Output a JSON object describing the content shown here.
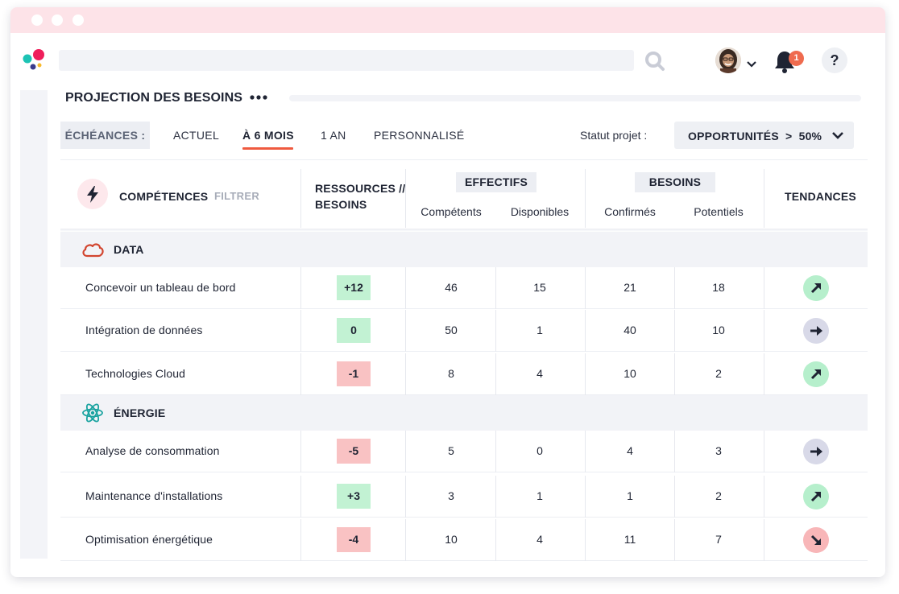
{
  "header": {
    "notification_count": "1",
    "help_label": "?"
  },
  "page": {
    "title": "PROJECTION DES BESOINS"
  },
  "echeances": {
    "label": "ÉCHÉANCES :",
    "tabs": [
      "ACTUEL",
      "À 6 MOIS",
      "1 AN",
      "PERSONNALISÉ"
    ],
    "active_tab": "À 6 MOIS"
  },
  "statut": {
    "label": "Statut projet :",
    "value": "OPPORTUNITÉS  >  50%"
  },
  "table": {
    "competences_header": "COMPÉTENCES",
    "filter_label": "FILTRER",
    "ressources_header_line1": "RESSOURCES //",
    "ressources_header_line2": "BESOINS",
    "effectifs_header": "EFFECTIFS",
    "effectifs_sub": [
      "Compétents",
      "Disponibles"
    ],
    "besoins_header": "BESOINS",
    "besoins_sub": [
      "Confirmés",
      "Potentiels"
    ],
    "tendances_header": "TENDANCES",
    "categories": [
      {
        "name": "DATA",
        "icon": "cloud-icon",
        "color": "#d2452f",
        "rows": [
          {
            "name": "Concevoir un tableau de bord",
            "delta": "+12",
            "delta_state": "pos",
            "competents": "46",
            "disponibles": "15",
            "confirmes": "21",
            "potentiels": "18",
            "trend": "up"
          },
          {
            "name": "Intégration de données",
            "delta": "0",
            "delta_state": "pos",
            "competents": "50",
            "disponibles": "1",
            "confirmes": "40",
            "potentiels": "10",
            "trend": "flat"
          },
          {
            "name": "Technologies Cloud",
            "delta": "-1",
            "delta_state": "neg",
            "competents": "8",
            "disponibles": "4",
            "confirmes": "10",
            "potentiels": "2",
            "trend": "up"
          }
        ]
      },
      {
        "name": "ÉNERGIE",
        "icon": "atom-icon",
        "color": "#1aa3a0",
        "rows": [
          {
            "name": "Analyse de consommation",
            "delta": "-5",
            "delta_state": "neg",
            "competents": "5",
            "disponibles": "0",
            "confirmes": "4",
            "potentiels": "3",
            "trend": "flat"
          },
          {
            "name": "Maintenance d'installations",
            "delta": "+3",
            "delta_state": "pos",
            "competents": "3",
            "disponibles": "1",
            "confirmes": "1",
            "potentiels": "2",
            "trend": "up"
          },
          {
            "name": "Optimisation énergétique",
            "delta": "-4",
            "delta_state": "neg",
            "competents": "10",
            "disponibles": "4",
            "confirmes": "11",
            "potentiels": "7",
            "trend": "down"
          }
        ]
      }
    ]
  },
  "colors": {
    "accent": "#ef5a3f",
    "positive": "#c2f2d3",
    "negative": "#f9c2c3",
    "trend_up": "#b6efcc",
    "trend_flat": "#d8d9e8",
    "trend_down": "#f8b6b8"
  }
}
